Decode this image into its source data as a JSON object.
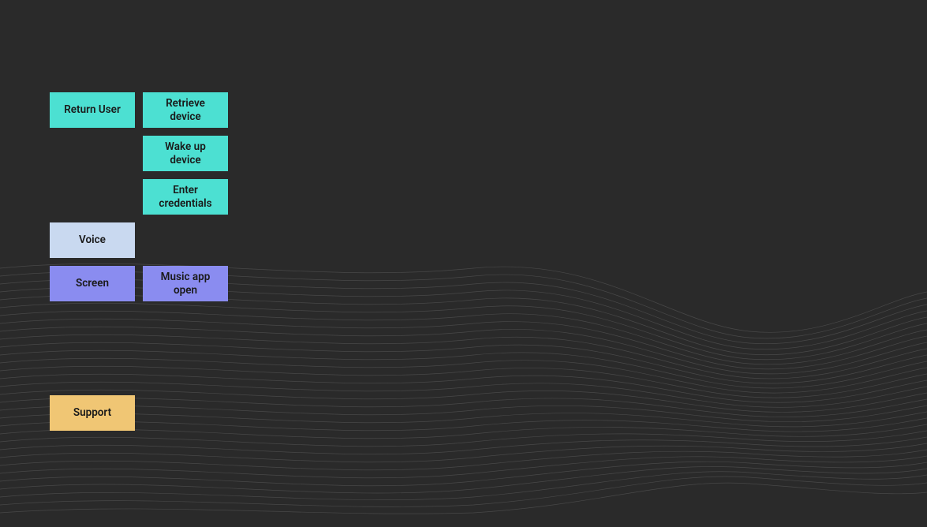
{
  "nodes": {
    "return_user": {
      "label": "Return User",
      "color": "teal"
    },
    "retrieve_device": {
      "label": "Retrieve device",
      "color": "teal"
    },
    "wake_up_device": {
      "label": "Wake up device",
      "color": "teal"
    },
    "enter_credentials": {
      "label": "Enter credentials",
      "color": "teal"
    },
    "voice": {
      "label": "Voice",
      "color": "light-blue"
    },
    "screen": {
      "label": "Screen",
      "color": "purple"
    },
    "music_app_open": {
      "label": "Music app open",
      "color": "purple"
    },
    "support": {
      "label": "Support",
      "color": "amber"
    }
  },
  "colors": {
    "teal": "#4ce0d2",
    "light-blue": "#c9d9f0",
    "purple": "#8a8cf0",
    "amber": "#f0c674",
    "background": "#2a2a2a",
    "wave_line": "#555555"
  }
}
